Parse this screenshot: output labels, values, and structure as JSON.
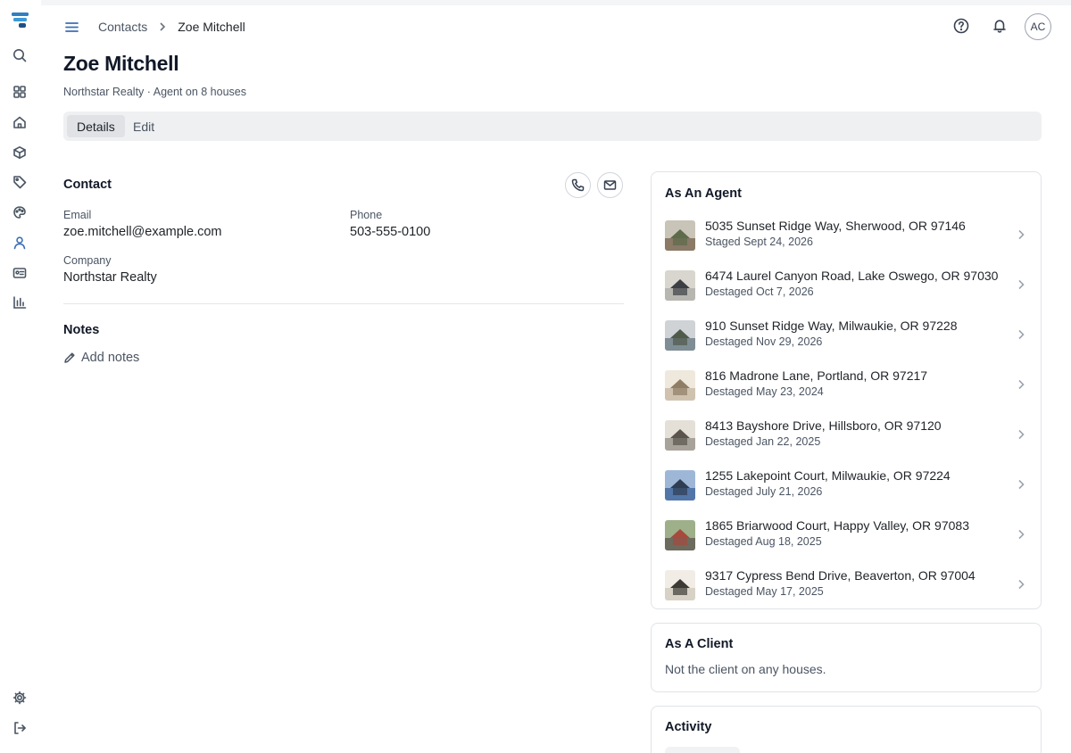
{
  "colors": {
    "accent": "#3d6fb6",
    "text": "#1f2328",
    "muted": "#4b5563",
    "border": "#e1e3e7",
    "tab_bg": "#eff0f2"
  },
  "sidebar": {
    "logo_icon": "app-logo",
    "items": [
      {
        "icon": "search-icon"
      },
      {
        "icon": "grid-icon"
      },
      {
        "icon": "home-icon"
      },
      {
        "icon": "box-icon"
      },
      {
        "icon": "tag-icon"
      },
      {
        "icon": "palette-icon"
      },
      {
        "icon": "person-icon"
      },
      {
        "icon": "id-card-icon"
      },
      {
        "icon": "bar-chart-icon"
      }
    ],
    "bottom_items": [
      {
        "icon": "gear-icon"
      },
      {
        "icon": "logout-icon"
      }
    ]
  },
  "header": {
    "breadcrumb": [
      "Contacts",
      "Zoe Mitchell"
    ],
    "avatar_initials": "AC"
  },
  "page": {
    "title": "Zoe Mitchell",
    "subtitle": "Northstar Realty · Agent on 8 houses"
  },
  "tabs": [
    {
      "label": "Details",
      "active": true
    },
    {
      "label": "Edit",
      "active": false
    }
  ],
  "contact": {
    "title": "Contact",
    "email_label": "Email",
    "email": "zoe.mitchell@example.com",
    "phone_label": "Phone",
    "phone": "503-555-0100",
    "company_label": "Company",
    "company": "Northstar Realty"
  },
  "notes": {
    "title": "Notes",
    "add_label": "Add notes"
  },
  "agent_card": {
    "title": "As An Agent",
    "houses": [
      {
        "address": "5035 Sunset Ridge Way, Sherwood, OR 97146",
        "status": "Staged Sept 24, 2026"
      },
      {
        "address": "6474 Laurel Canyon Road, Lake Oswego, OR 97030",
        "status": "Destaged Oct 7, 2026"
      },
      {
        "address": "910 Sunset Ridge Way, Milwaukie, OR 97228",
        "status": "Destaged Nov 29, 2026"
      },
      {
        "address": "816 Madrone Lane, Portland, OR 97217",
        "status": "Destaged May 23, 2024"
      },
      {
        "address": "8413 Bayshore Drive, Hillsboro, OR 97120",
        "status": "Destaged Jan 22, 2025"
      },
      {
        "address": "1255 Lakepoint Court, Milwaukie, OR 97224",
        "status": "Destaged July 21, 2026"
      },
      {
        "address": "1865 Briarwood Court, Happy Valley, OR 97083",
        "status": "Destaged Aug 18, 2025"
      },
      {
        "address": "9317 Cypress Bend Drive, Beaverton, OR 97004",
        "status": "Destaged May 17, 2025"
      }
    ]
  },
  "client_card": {
    "title": "As A Client",
    "empty_text": "Not the client on any houses."
  },
  "activity_card": {
    "title": "Activity"
  }
}
